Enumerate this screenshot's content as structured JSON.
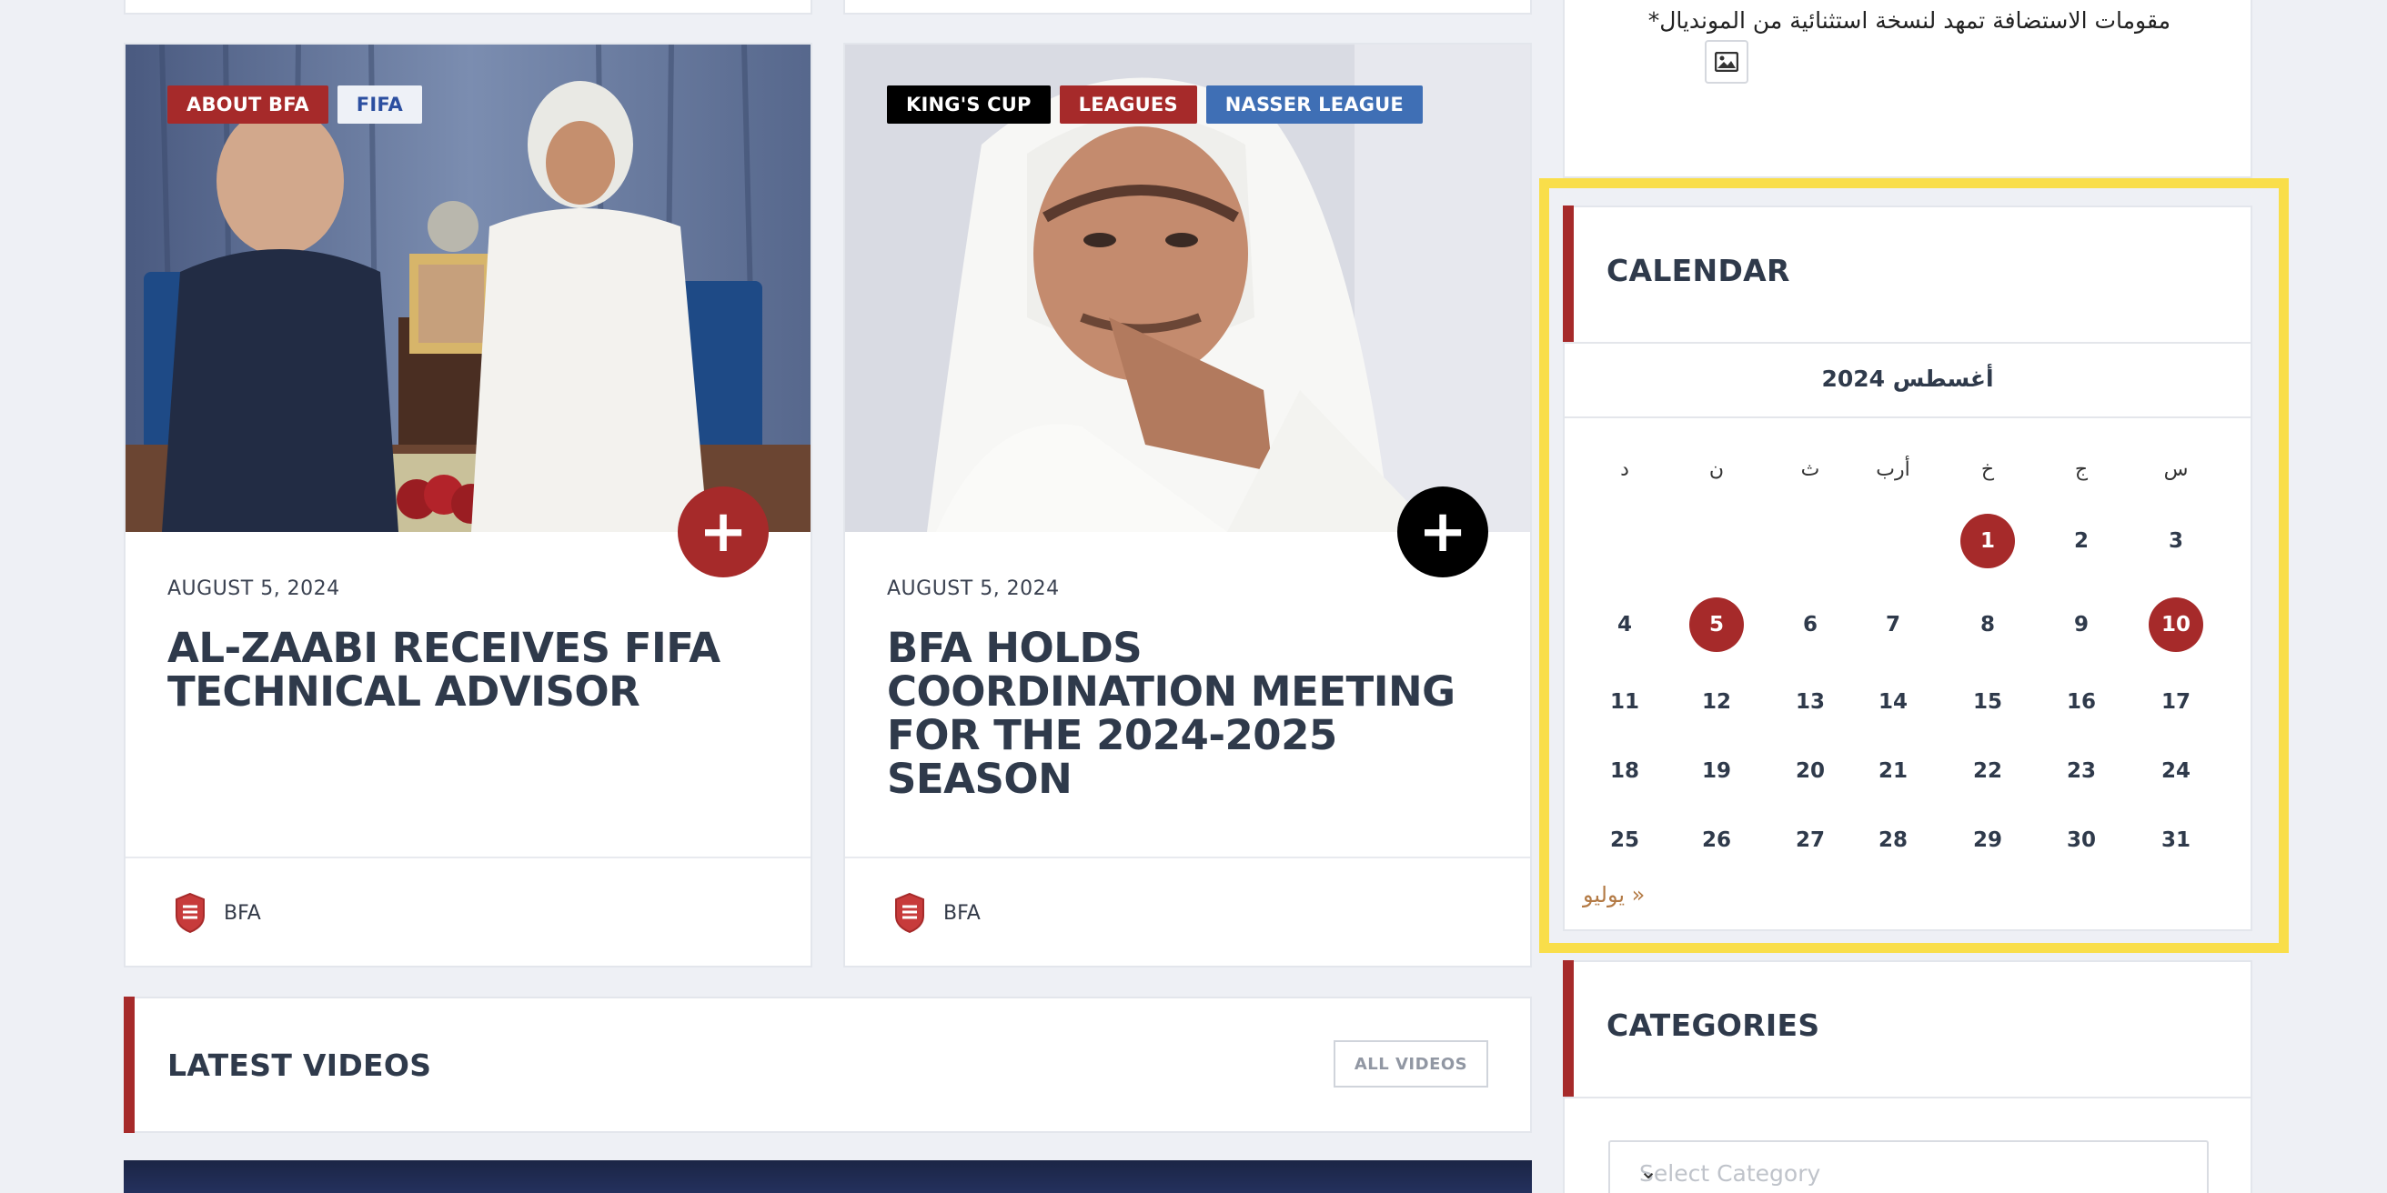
{
  "posts": [
    {
      "tags": [
        {
          "label": "ABOUT BFA",
          "bg": "#a62a2a",
          "fg": "#ffffff"
        },
        {
          "label": "FIFA",
          "bg": "#eef1f7",
          "fg": "#2c4fa0"
        }
      ],
      "plus_color": "#a62a2a",
      "date": "AUGUST 5, 2024",
      "title": "AL-ZAABI RECEIVES FIFA TECHNICAL ADVISOR",
      "author": "BFA"
    },
    {
      "tags": [
        {
          "label": "KING'S CUP",
          "bg": "#000000",
          "fg": "#ffffff"
        },
        {
          "label": "LEAGUES",
          "bg": "#a62a2a",
          "fg": "#ffffff"
        },
        {
          "label": "NASSER LEAGUE",
          "bg": "#3f6fb5",
          "fg": "#ffffff"
        }
      ],
      "plus_color": "#000000",
      "date": "AUGUST 5, 2024",
      "title": "BFA HOLDS COORDINATION MEETING FOR THE 2024-2025 SEASON",
      "author": "BFA"
    }
  ],
  "sidebar": {
    "top_text": "مقومات الاستضافة تمهد لنسخة استثنائية من المونديال*",
    "calendar": {
      "title": "CALENDAR",
      "month": "أغسطس 2024",
      "weekdays": [
        "د",
        "ن",
        "ث",
        "أرب",
        "خ",
        "ج",
        "س"
      ],
      "weeks": [
        [
          "",
          "",
          "",
          "",
          "1",
          "2",
          "3"
        ],
        [
          "4",
          "5",
          "6",
          "7",
          "8",
          "9",
          "10"
        ],
        [
          "11",
          "12",
          "13",
          "14",
          "15",
          "16",
          "17"
        ],
        [
          "18",
          "19",
          "20",
          "21",
          "22",
          "23",
          "24"
        ],
        [
          "25",
          "26",
          "27",
          "28",
          "29",
          "30",
          "31"
        ]
      ],
      "highlighted_days": [
        "1",
        "5",
        "10"
      ],
      "prev_link": "« يوليو"
    },
    "categories": {
      "title": "CATEGORIES",
      "placeholder": "Select Category"
    }
  },
  "videos": {
    "title": "LATEST VIDEOS",
    "button": "ALL VIDEOS"
  },
  "colors": {
    "accent": "#a62a2a",
    "highlight": "#f9de4a",
    "text_dark": "#2f3a4b"
  }
}
